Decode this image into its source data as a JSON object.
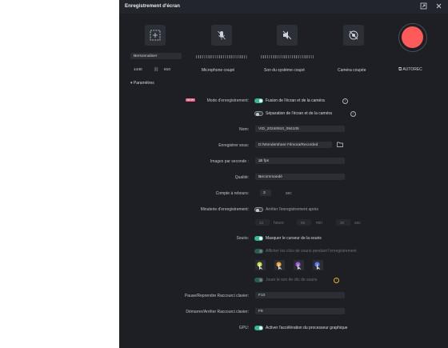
{
  "window": {
    "title": "Enregistrement d'écran"
  },
  "sources": {
    "custom_select": "Personnaliser",
    "width": "1440",
    "height": "810",
    "microphone_label": "Microphone coupé",
    "system_sound_label": "Son du système coupé",
    "camera_label": "Caméra coupée",
    "autorec_label": "AUTOREC"
  },
  "settings": {
    "header": "Paramètres",
    "mode_badge": "NEW",
    "mode_label": "Mode d'enregistrement:",
    "mode_option1": "Fusion de l'écran et de la caméra",
    "mode_option2": "Séparation de l'écran et de la caméra",
    "name_label": "Nom:",
    "name_value": "VID_20240910_084105",
    "save_label": "Enregistrer sous:",
    "save_value": "D:/Wondershare Filmora/Recorded",
    "fps_label": "Images par seconde :",
    "fps_value": "25 fps",
    "quality_label": "Qualité:",
    "quality_value": "Recommandé",
    "countdown_label": "Compte à rebours:",
    "countdown_value": "3",
    "countdown_unit": "sec",
    "timer_label": "Minuterie d'enregistrement:",
    "timer_option": "Arrêter l'enregistrement après",
    "timer_hours_value": "23",
    "timer_hours_unit": "heure",
    "timer_minutes_value": "59",
    "timer_minutes_unit": "min",
    "timer_seconds_value": "30",
    "timer_seconds_unit": "sec",
    "mouse_label": "Souris:",
    "mouse_option1": "Masquer le curseur de la souris",
    "mouse_option2": "Afficher les clics de souris pendant l'enregistrement",
    "mouse_option3": "Jouer le son de clic de souris",
    "pause_label": "Pause/Reprendre Raccourci clavier:",
    "pause_value": "F10",
    "startstop_label": "Démarrer/Arrêter Raccourci clavier:",
    "startstop_value": "F9",
    "gpu_label": "GPU:",
    "gpu_option": "Activer l'accélération du processeur graphique"
  },
  "colors": {
    "record": "#ff5a5a",
    "toggle_on": "#39b59a",
    "badge": "#e8577f"
  }
}
